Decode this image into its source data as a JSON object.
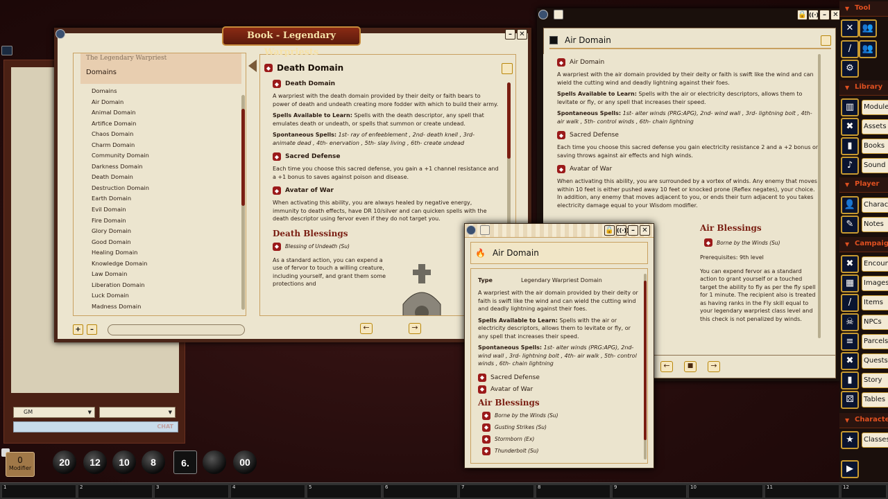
{
  "book": {
    "title": "Book - Legendary Warpriests",
    "toc_book": "The Legendary Warpriest",
    "toc_header": "Domains",
    "toc_items": [
      "Domains",
      "Air Domain",
      "Animal Domain",
      "Artifice Domain",
      "Chaos Domain",
      "Charm Domain",
      "Community Domain",
      "Darkness Domain",
      "Death Domain",
      "Destruction Domain",
      "Earth Domain",
      "Evil Domain",
      "Fire Domain",
      "Glory Domain",
      "Good Domain",
      "Healing Domain",
      "Knowledge Domain",
      "Law Domain",
      "Liberation Domain",
      "Luck Domain",
      "Madness Domain"
    ],
    "page_title": "Death Domain",
    "sub1": "Death Domain",
    "p1": "A warpriest with the death domain provided by their deity or faith bears to power of death and undeath creating more fodder with which to build their army.",
    "spells_label": "Spells Available to Learn:",
    "spells_text": " Spells with the death descriptor, any spell that emulates death or undeath, or spells that summon or create undead.",
    "spont_label": "Spontaneous Spells:",
    "spont_text": " 1st- ray of enfeeblement , 2nd- death knell , 3rd- animate dead , 4th- enervation , 5th- slay living , 6th- create undead",
    "sub2": "Sacred Defense",
    "p2": "Each time you choose this sacred defense, you gain a +1 channel resistance and a +1 bonus to saves against poison and disease.",
    "sub3": "Avatar of War",
    "p3": "When activating this ability, you are always healed by negative energy, immunity to death effects, have DR 10/silver and can quicken spells with the death descriptor using fervor even if they do not target you.",
    "blessings_title": "Death Blessings",
    "blessing1": "Blessing of Undeath (Su)",
    "p4": "As a standard action, you can expend a use of fervor to touch a willing creature, including yourself, and grant them some protections and"
  },
  "air_window": {
    "title": "Air Domain",
    "sub1": "Air Domain",
    "p1": "A warpriest with the air domain provided by their deity or faith is swift like the wind and can wield the cutting wind and deadly lightning against their foes.",
    "spells_label": "Spells Available to Learn:",
    "spells_text": " Spells with the air or electricity descriptors, allows them to levitate or fly, or any spell that increases their speed.",
    "spont_label": "Spontaneous Spells:",
    "spont_text": " 1st- alter winds (PRG:APG), 2nd- wind wall , 3rd- lightning bolt , 4th- air walk , 5th- control winds , 6th- chain lightning",
    "sub2": "Sacred Defense",
    "p2": "Each time you choose this sacred defense you gain electricity resistance 2 and a +2 bonus on saving throws against air effects and high winds.",
    "sub3": "Avatar of War",
    "p3": "When activating this ability, you are surrounded by a vortex of winds. Any enemy that moves within 10 feet is either pushed away 10 feet or knocked prone (Reflex negates), your choice. In addition, any enemy that moves adjacent to you, or ends their turn adjacent to you takes electricity damage equal to your Wisdom modifier.",
    "blessings_title": "Air Blessings",
    "blessing1": "Borne by the Winds (Su)",
    "prereq": "Prerequisites: 9th level",
    "p4": "You can expend fervor as a standard action to grant yourself or a touched target the ability to fly as per the fly spell for 1 minute. The recipient also is treated as having ranks in the Fly skill equal to your legendary warpriest class level and this check is not penalized by winds."
  },
  "popup": {
    "title": "Air Domain",
    "type_label": "Type",
    "type_value": "Legendary Warpriest Domain",
    "p1": "A warpriest with the air domain provided by their deity or faith is swift like the wind and can wield the cutting wind and deadly lightning against their foes.",
    "spells_label": "Spells Available to Learn:",
    "spells_text": " Spells with the air or electricity descriptors, allows them to levitate or fly, or any spell that increases their speed.",
    "spont_label": "Spontaneous Spells:",
    "spont_text": " 1st- alter winds (PRG:APG), 2nd- wind wall , 3rd- lightning bolt , 4th- air walk , 5th- control winds , 6th- chain lightning",
    "link1": "Sacred Defense",
    "link2": "Avatar of War",
    "blessings_title": "Air Blessings",
    "blessings": [
      "Borne by the Winds (Su)",
      "Gusting Strikes (Su)",
      "Stormborn (Ex)",
      "Thunderbolt (Su)"
    ]
  },
  "chat": {
    "identity": "GM",
    "language": "",
    "send_label": "CHAT"
  },
  "modifier": {
    "value": "0",
    "label": "Modifier"
  },
  "dice": [
    "20",
    "12",
    "10",
    "8",
    "6.",
    "",
    "00"
  ],
  "hotkeys": [
    "1",
    "2",
    "3",
    "4",
    "5",
    "6",
    "7",
    "8",
    "9",
    "10",
    "11",
    "12"
  ],
  "sidebar": {
    "tool_label": "Tool",
    "library_label": "Library",
    "library_items": [
      "Modules",
      "Assets",
      "Books",
      "Sound"
    ],
    "player_label": "Player",
    "player_items": [
      "Character",
      "Notes"
    ],
    "campaign_label": "Campaign",
    "campaign_items": [
      "Encounters",
      "Images",
      "Items",
      "NPCs",
      "Parcels",
      "Quests",
      "Story",
      "Tables"
    ],
    "character_label": "Character",
    "character_items": [
      "Classes"
    ]
  }
}
